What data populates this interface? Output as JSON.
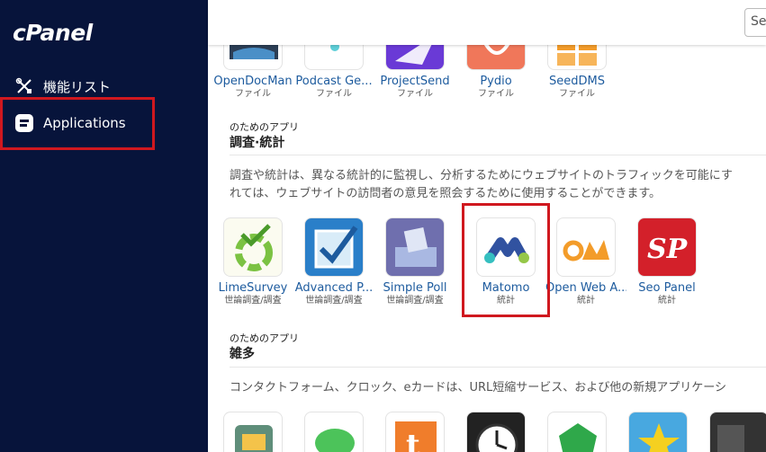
{
  "sidebar": {
    "logo": "cPanel",
    "items": [
      {
        "label": "機能リスト",
        "icon": "tools-icon"
      },
      {
        "label": "Applications",
        "icon": "applications-icon"
      }
    ]
  },
  "search": {
    "placeholder": "Se"
  },
  "top_apps": [
    {
      "name": "OpenDocMan",
      "category": "ファイル"
    },
    {
      "name": "Podcast Ge...",
      "category": "ファイル"
    },
    {
      "name": "ProjectSend",
      "category": "ファイル"
    },
    {
      "name": "Pydio",
      "category": "ファイル"
    },
    {
      "name": "SeedDMS",
      "category": "ファイル"
    }
  ],
  "survey_section": {
    "subtitle": "のためのアプリ",
    "title": "調査·統計",
    "description_line1": "調査や統計は、異なる統計的に監視し、分析するためにウェブサイトのトラフィックを可能にす",
    "description_line2": "れては、ウェブサイトの訪問者の意見を照会するために使用することができます。",
    "apps": [
      {
        "name": "LimeSurvey",
        "category": "世論調査/調査"
      },
      {
        "name": "Advanced P...",
        "category": "世論調査/調査"
      },
      {
        "name": "Simple Poll",
        "category": "世論調査/調査"
      },
      {
        "name": "Matomo",
        "category": "統計"
      },
      {
        "name": "Open Web A...",
        "category": "統計"
      },
      {
        "name": "Seo Panel",
        "category": "統計"
      }
    ]
  },
  "misc_section": {
    "subtitle": "のためのアプリ",
    "title": "雑多",
    "description_line1": "コンタクトフォーム、クロック、eカードは、URL短縮サービス、および他の新規アプリケーシ"
  },
  "colors": {
    "sidebar": "#07143b",
    "highlight": "#d0181f",
    "link": "#1d5b9e"
  }
}
